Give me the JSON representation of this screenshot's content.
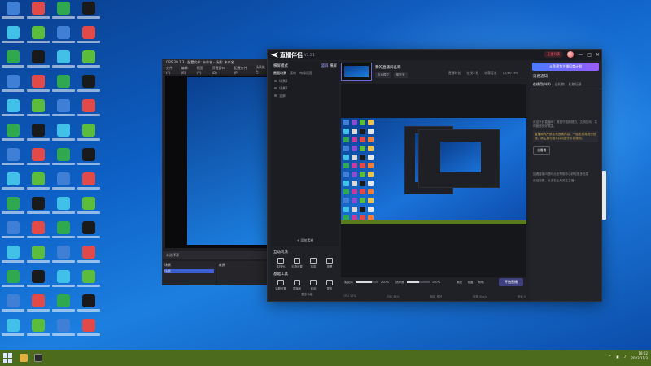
{
  "obs": {
    "title": "OBS 29.1.3 - 配置文件: 未命名 - 场景: 未命名",
    "menu": [
      "文件(F)",
      "编辑(E)",
      "视图(V)",
      "停靠窗口(D)",
      "配置文件(P)",
      "场景集合"
    ],
    "scene_bar": "未选择源",
    "dock_scenes_title": "场景",
    "dock_scenes_item": "场景",
    "dock_sources_title": "来源"
  },
  "app": {
    "name": "直播伴侣",
    "version": "V5.5.1",
    "live_pill": "正播列表",
    "window_controls": [
      "—",
      "□",
      "✕"
    ],
    "left": {
      "mode": "横屏模式",
      "portrait": "竖屏",
      "landscape": "横屏",
      "tabs": [
        "画面场景",
        "素材",
        "布局设置"
      ],
      "rows": [
        "场景1",
        "场景2",
        "全屏"
      ],
      "add_material": "+ 添加素材"
    },
    "room": {
      "title": "我的直播间名称",
      "tags": [
        "互动模式",
        "聊天室"
      ]
    },
    "stats": [
      "直播时长",
      "在线人数",
      "收获音浪",
      "17/60 FPS"
    ],
    "right": {
      "banner": "斗鱼潜力主播培育计划",
      "title": "消息通知",
      "tabs": [
        "在线用户(0)",
        "送礼物",
        "礼物记录"
      ],
      "msg1": "欢迎来到直播间！请遵守直播规范，文明互动，共同营造良好氛围。",
      "msg_hi": "直播间内严禁发布违规内容，一经发现将进行处理，请主播与观众共同遵守平台规则。",
      "button": "去看看",
      "msg2": "如遇直播问题可点击帮助中心获取更多信息",
      "msg3": "欢迎观看，点击右上角关注主播~"
    },
    "tools": {
      "title": "互动玩法",
      "items": [
        "连线PK",
        "礼物设置",
        "抽奖",
        "投票",
        "弹幕",
        "房管",
        "粉丝团",
        "截图"
      ],
      "title2": "基础工具",
      "items2": [
        "话题设置",
        "直播间",
        "商品",
        "更多",
        "主题",
        "清屏",
        "录屏",
        "美颜"
      ],
      "more": "··· 更多功能"
    },
    "bottom": {
      "mic_label": "麦克风",
      "mic_value": "200%",
      "spk_label": "扬声器",
      "spk_value": "100%",
      "mini": [
        "画质",
        "设置",
        "帮助"
      ],
      "go_live": "开始直播"
    },
    "status": [
      "CPU 12%",
      "内存 45%",
      "网络 良好",
      "码率 0kb/s",
      "丢帧 0"
    ],
    "mic_fill": 0.72,
    "spk_fill": 0.55
  },
  "taskbar": {
    "time": "18:02",
    "date": "2023/11/3"
  },
  "colors": {
    "accent": "#5b5ee0",
    "live_red": "#ff5b6b",
    "taskbar": "#4d6b1c"
  }
}
